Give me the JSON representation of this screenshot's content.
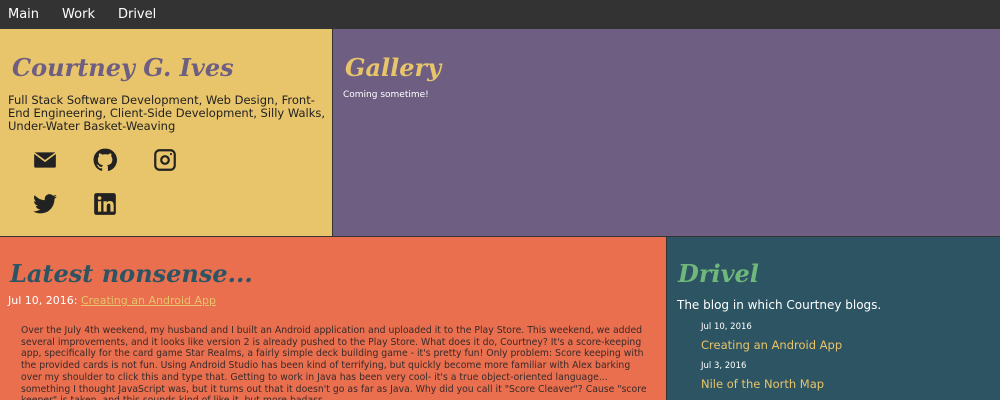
{
  "nav": {
    "items": [
      "Main",
      "Work",
      "Drivel"
    ]
  },
  "profile": {
    "name": "Courtney G. Ives",
    "tagline": "Full Stack Software Development, Web Design, Front-End Engineering, Client-Side Development, Silly Walks, Under-Water Basket-Weaving",
    "icons": [
      "email-icon",
      "github-icon",
      "instagram-icon",
      "twitter-icon",
      "linkedin-icon"
    ]
  },
  "gallery": {
    "title": "Gallery",
    "subtitle": "Coming sometime!"
  },
  "nonsense": {
    "title": "Latest nonsense...",
    "post_date": "Jul 10, 2016:",
    "post_title": "Creating an Android App",
    "excerpt": "Over the July 4th weekend, my husband and I built an Android application and uploaded it to the Play Store. This weekend, we added several improvements, and it looks like version 2 is already pushed to the Play Store. What does it do, Courtney? It's a score-keeping app, specifically for the card game Star Realms, a fairly simple deck building game - it's pretty fun! Only problem: Score keeping with the provided cards is not fun. Using Android Studio has been kind of terrifying, but quickly become more familiar with Alex barking over my shoulder to click this and type that. Getting to work in Java has been very cool- it's a true object-oriented language... something I thought JavaScript was, but it turns out that it doesn't go as far as Java. Why did you call it \"Score Cleaver\"? Cause \"score keeper\" is taken, and this sounds kind of like it, but more badass."
  },
  "drivel": {
    "title": "Drivel",
    "lead": "The blog in which Courtney blogs.",
    "posts": [
      {
        "date": "Jul 10, 2016",
        "title": "Creating an Android App"
      },
      {
        "date": "Jul 3, 2016",
        "title": "Nile of the North Map"
      }
    ]
  },
  "colors": {
    "yellow": "#E8C46A",
    "purple": "#6E5E82",
    "coral": "#E96F4E",
    "teal": "#2D5463",
    "green": "#6FB77A",
    "nav": "#333333"
  }
}
